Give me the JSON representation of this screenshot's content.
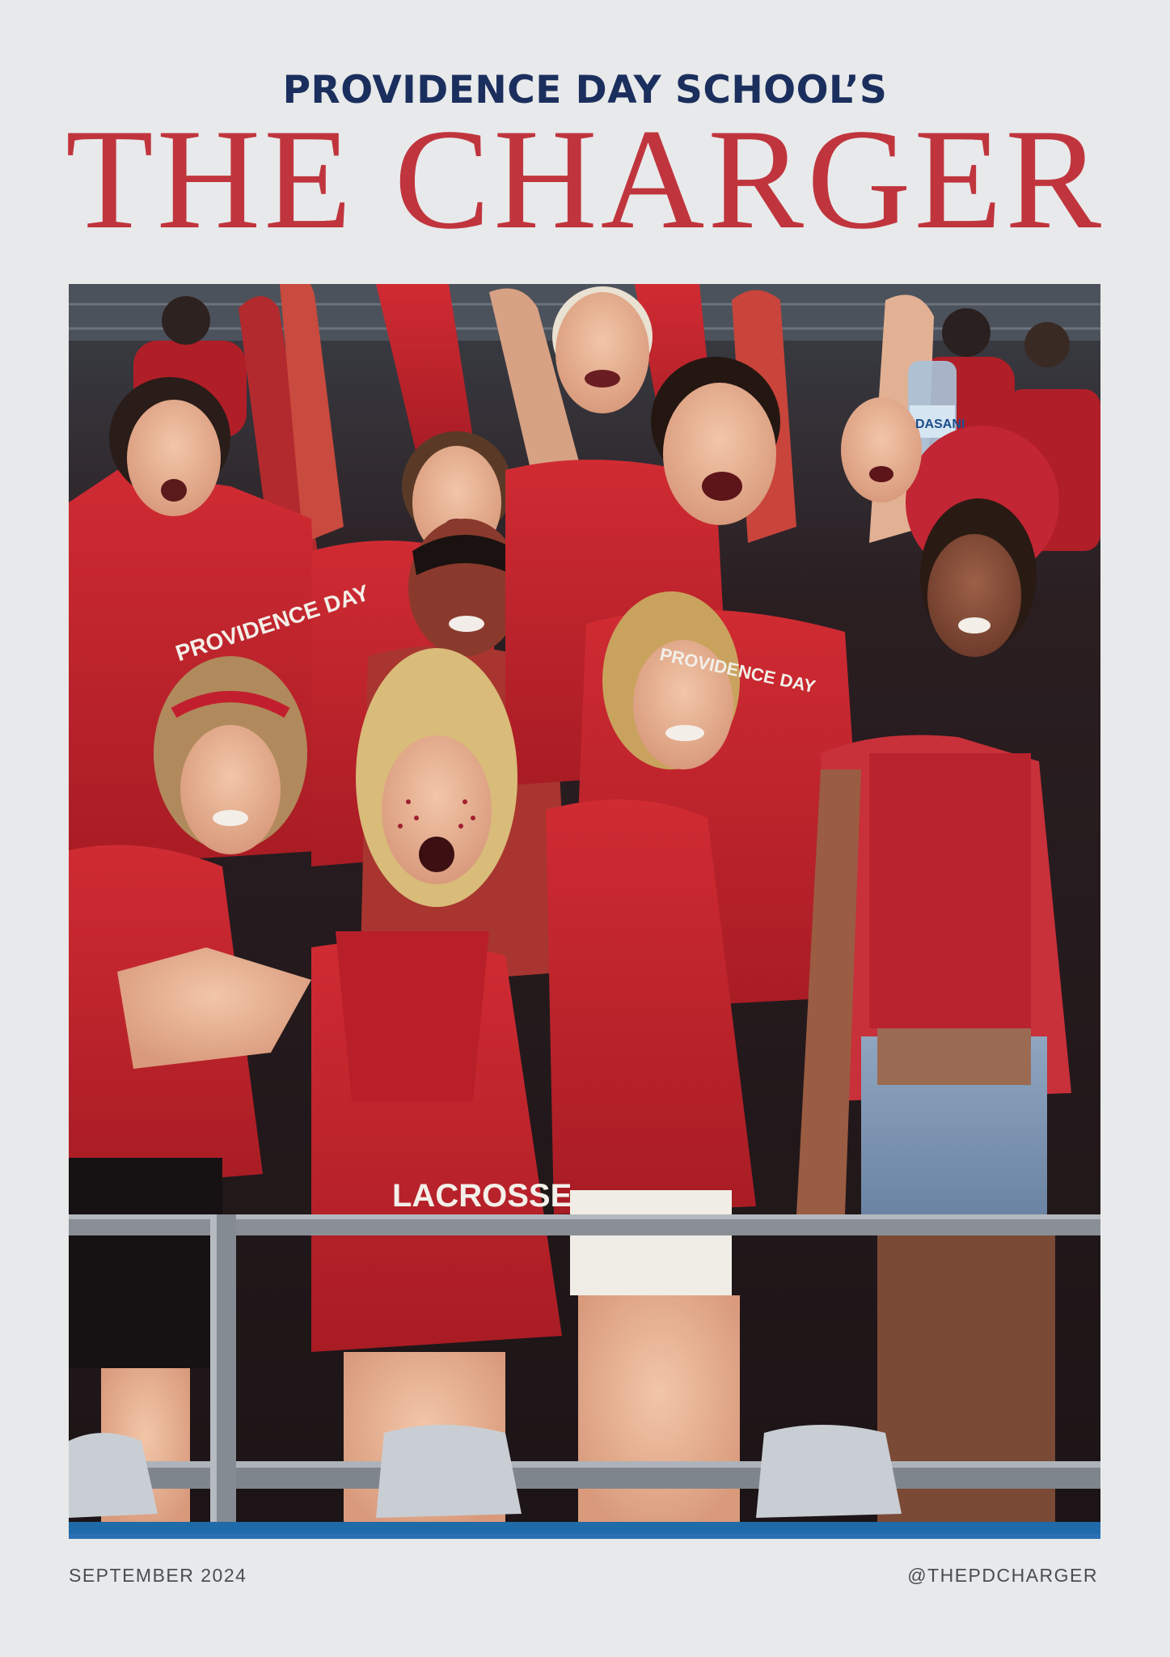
{
  "masthead": {
    "kicker": "PROVIDENCE DAY SCHOOL’S",
    "title": "THE CHARGER"
  },
  "cover_photo": {
    "shirt_texts": [
      "PROVIDENCE DAY",
      "PROVIDENCE DAY",
      "LACROSSE",
      "DASANI"
    ]
  },
  "footer": {
    "date": "SEPTEMBER 2024",
    "handle": "@THEPDCHARGER"
  },
  "colors": {
    "kicker_navy": "#1b2f5e",
    "title_red": "#c0353d",
    "background": "#e8e9ea",
    "stripe_blue": "#2b6fb4"
  }
}
